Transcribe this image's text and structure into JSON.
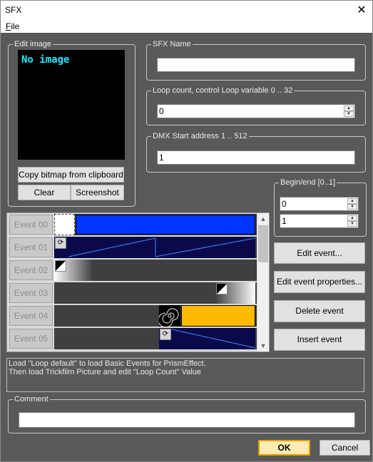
{
  "window": {
    "title": "SFX",
    "close_glyph": "✕"
  },
  "menu": {
    "file_accel": "F",
    "file_rest": "ile"
  },
  "edit_image": {
    "label": "Edit image",
    "placeholder": "No image",
    "copy_button": "Copy bitmap from clipboard",
    "clear_button": "Clear",
    "screenshot_button": "Screenshot"
  },
  "sfx_name": {
    "label": "SFX Name",
    "value": ""
  },
  "loop_count": {
    "label": "Loop count, control Loop variable 0 .. 32",
    "value": "0"
  },
  "dmx_start": {
    "label": "DMX Start address 1 .. 512",
    "value": "1"
  },
  "begin_end": {
    "label": "Begin/end [0..1]",
    "begin": "0",
    "end": "1"
  },
  "events": {
    "rows": [
      {
        "label": "Event 00"
      },
      {
        "label": "Event 01"
      },
      {
        "label": "Event 02"
      },
      {
        "label": "Event 03"
      },
      {
        "label": "Event 04"
      },
      {
        "label": "Event 05"
      }
    ],
    "colors": {
      "blue": "#0033ff",
      "navy": "#0a0a4a",
      "orange": "#ffbb00",
      "track": "#3f3f3f"
    }
  },
  "buttons": {
    "edit_event": "Edit event...",
    "edit_event_properties": "Edit event properties...",
    "delete_event": "Delete event",
    "insert_event": "Insert event"
  },
  "info_text": {
    "line1": "Load \"Loop default\" to load Basic Events for PrismEffect.",
    "line2": "Then load Trickfilm Picture and edit \"Loop Count\" Value"
  },
  "comment": {
    "label": "Comment",
    "value": ""
  },
  "footer": {
    "ok": "OK",
    "cancel": "Cancel"
  }
}
